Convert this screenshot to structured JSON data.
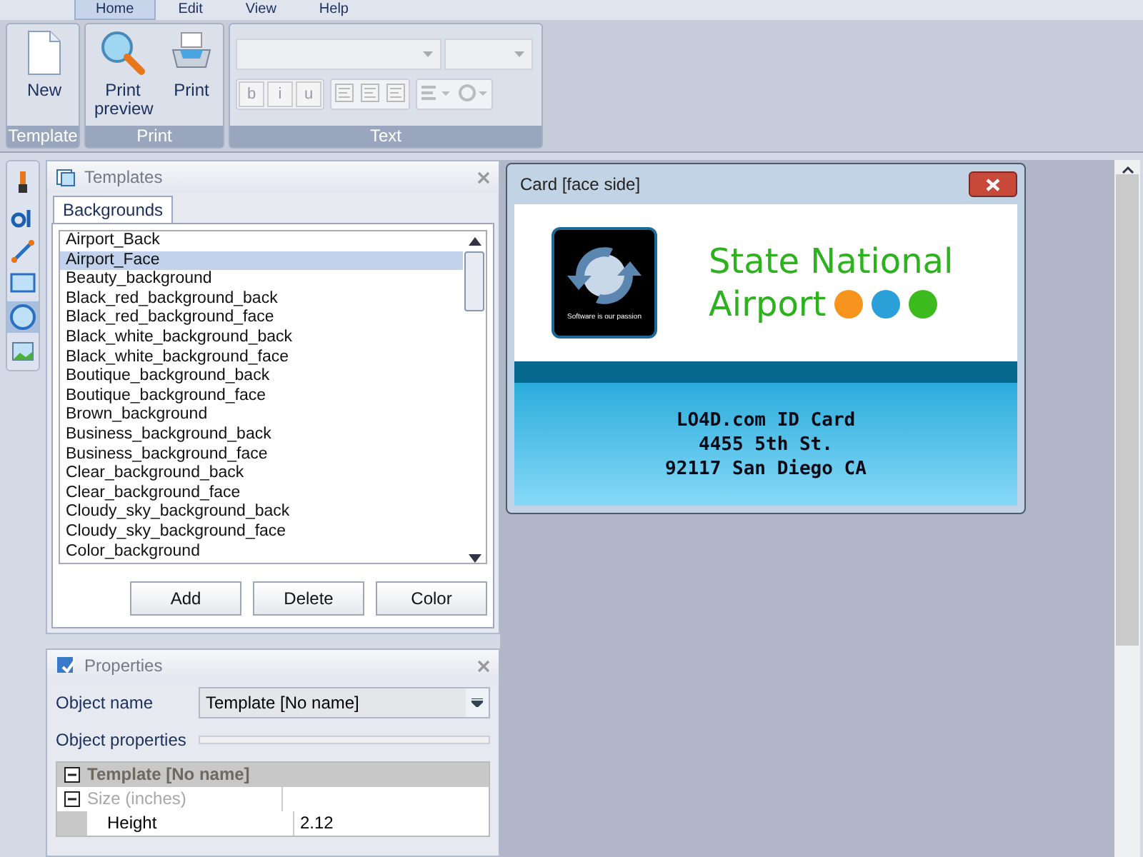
{
  "menu_tabs": [
    {
      "label": "Home",
      "selected": true
    },
    {
      "label": "Edit",
      "selected": false
    },
    {
      "label": "View",
      "selected": false
    },
    {
      "label": "Help",
      "selected": false
    }
  ],
  "ribbon": {
    "groups": [
      {
        "kind": "template",
        "title": "Template",
        "buttons": [
          {
            "label": "New"
          }
        ]
      },
      {
        "kind": "print",
        "title": "Print",
        "buttons": [
          {
            "label": "Print preview"
          },
          {
            "label": "Print"
          }
        ]
      },
      {
        "kind": "text",
        "title": "Text",
        "format_buttons": [
          {
            "label": "b",
            "disabled": true
          },
          {
            "label": "i",
            "disabled": true
          },
          {
            "label": "u",
            "disabled": true
          }
        ]
      }
    ]
  },
  "templates_panel": {
    "title": "Templates",
    "tabs": [
      {
        "label": "Backgrounds",
        "selected": true
      }
    ],
    "items": [
      {
        "label": "Airport_Back",
        "selected": false
      },
      {
        "label": "Airport_Face",
        "selected": true
      },
      {
        "label": "Beauty_background",
        "selected": false
      },
      {
        "label": "Black_red_background_back",
        "selected": false
      },
      {
        "label": "Black_red_background_face",
        "selected": false
      },
      {
        "label": "Black_white_background_back",
        "selected": false
      },
      {
        "label": "Black_white_background_face",
        "selected": false
      },
      {
        "label": "Boutique_background_back",
        "selected": false
      },
      {
        "label": "Boutique_background_face",
        "selected": false
      },
      {
        "label": "Brown_background",
        "selected": false
      },
      {
        "label": "Business_background_back",
        "selected": false
      },
      {
        "label": "Business_background_face",
        "selected": false
      },
      {
        "label": "Clear_background_back",
        "selected": false
      },
      {
        "label": "Clear_background_face",
        "selected": false
      },
      {
        "label": "Cloudy_sky_background_back",
        "selected": false
      },
      {
        "label": "Cloudy_sky_background_face",
        "selected": false
      },
      {
        "label": "Color_background",
        "selected": false
      }
    ],
    "buttons": [
      "Add",
      "Delete",
      "Color"
    ]
  },
  "properties_panel": {
    "title": "Properties",
    "object_name_label": "Object name",
    "object_name": "Template [No name]",
    "object_properties_label": "Object properties",
    "grid": [
      {
        "kind": "group",
        "label": "Template [No name]",
        "expanded": true
      },
      {
        "kind": "subgroup",
        "label": "Size (inches)",
        "expanded": true
      },
      {
        "kind": "property",
        "label": "Height",
        "value": "2.12"
      }
    ]
  },
  "card_window": {
    "title": "Card [face side]",
    "logo_tagline": "Software is our passion",
    "heading_lines": [
      "State National",
      "Airport"
    ],
    "dots": [
      {
        "color": "#f7941d"
      },
      {
        "color": "#2b9fd8"
      },
      {
        "color": "#3dbb1e"
      }
    ],
    "body_lines": [
      "LO4D.com ID Card",
      "4455 5th St.",
      "92117 San Diego CA"
    ]
  }
}
